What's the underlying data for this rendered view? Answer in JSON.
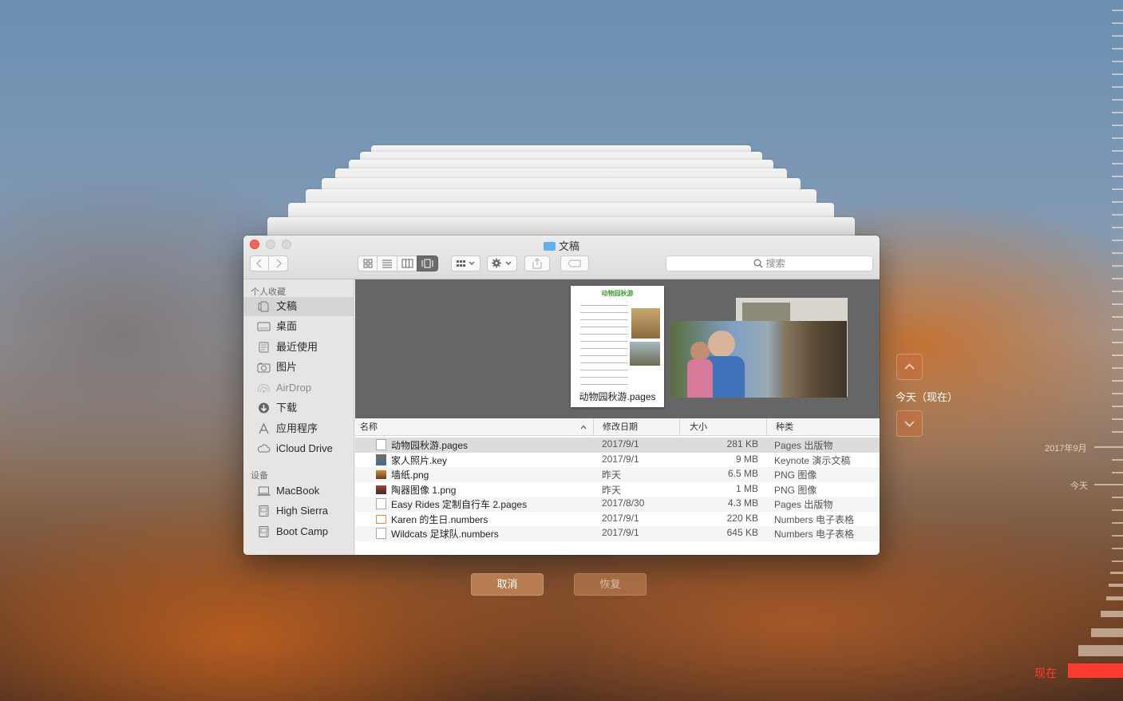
{
  "window": {
    "title": "文稿",
    "search_placeholder": "搜索"
  },
  "toolbar": {
    "back_icon": "chevron-left-icon",
    "forward_icon": "chevron-right-icon",
    "view_buttons": [
      "icon-view",
      "list-view",
      "column-view",
      "cover-flow-view"
    ],
    "arrange_icon": "arrange-grid-icon",
    "action_icon": "gear-icon",
    "share_icon": "share-icon",
    "tag_icon": "tag-icon"
  },
  "sidebar": {
    "favorites_header": "个人收藏",
    "favorites": [
      {
        "label": "文稿",
        "icon": "documents-icon",
        "selected": true
      },
      {
        "label": "桌面",
        "icon": "desktop-icon"
      },
      {
        "label": "最近使用",
        "icon": "recents-icon"
      },
      {
        "label": "图片",
        "icon": "camera-icon"
      },
      {
        "label": "AirDrop",
        "icon": "airdrop-icon"
      },
      {
        "label": "下载",
        "icon": "download-icon"
      },
      {
        "label": "应用程序",
        "icon": "applications-icon"
      },
      {
        "label": "iCloud Drive",
        "icon": "cloud-icon"
      }
    ],
    "devices_header": "设备",
    "devices": [
      {
        "label": "MacBook",
        "icon": "laptop-icon"
      },
      {
        "label": "High Sierra",
        "icon": "disk-icon"
      },
      {
        "label": "Boot Camp",
        "icon": "disk-icon"
      }
    ]
  },
  "preview": {
    "caption": "动物园秋游.pages",
    "doc_title": "动物园秋游"
  },
  "list": {
    "columns": {
      "name": "名称",
      "date": "修改日期",
      "size": "大小",
      "kind": "种类"
    },
    "rows": [
      {
        "name": "动物园秋游.pages",
        "date": "2017/9/1",
        "size": "281 KB",
        "kind": "Pages 出版物",
        "selected": true
      },
      {
        "name": "家人照片.key",
        "date": "2017/9/1",
        "size": "9 MB",
        "kind": "Keynote 演示文稿"
      },
      {
        "name": "墙纸.png",
        "date": "昨天",
        "size": "6.5 MB",
        "kind": "PNG 图像"
      },
      {
        "name": "陶器图像 1.png",
        "date": "昨天",
        "size": "1 MB",
        "kind": "PNG 图像"
      },
      {
        "name": "Easy Rides 定制自行车 2.pages",
        "date": "2017/8/30",
        "size": "4.3 MB",
        "kind": "Pages 出版物"
      },
      {
        "name": "Karen 的生日.numbers",
        "date": "2017/9/1",
        "size": "220 KB",
        "kind": "Numbers 电子表格"
      },
      {
        "name": "Wildcats 足球队.numbers",
        "date": "2017/9/1",
        "size": "645 KB",
        "kind": "Numbers 电子表格"
      }
    ]
  },
  "buttons": {
    "cancel": "取消",
    "restore": "恢复"
  },
  "timemachine": {
    "current_label": "今天（现在）",
    "timeline_month": "2017年9月",
    "timeline_today": "今天",
    "timeline_now": "现在",
    "now_color": "#ff3b30"
  }
}
